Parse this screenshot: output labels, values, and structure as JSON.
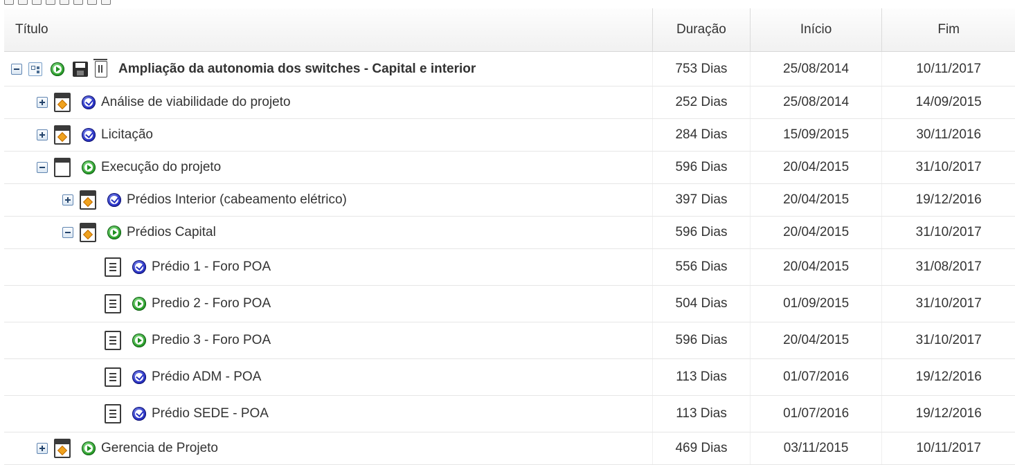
{
  "columns": {
    "title": "Título",
    "duration": "Duração",
    "start": "Início",
    "end": "Fim"
  },
  "rows": [
    {
      "title": "Ampliação da autonomia dos switches - Capital e interior",
      "duration": "753 Dias",
      "start": "25/08/2014",
      "end": "10/11/2017",
      "level": 0,
      "toggle": "minus",
      "status": "in-progress",
      "root": true
    },
    {
      "title": "Análise de viabilidade do projeto",
      "duration": "252 Dias",
      "start": "25/08/2014",
      "end": "14/09/2015",
      "level": 1,
      "toggle": "plus",
      "status": "completed",
      "task_icon": "summary"
    },
    {
      "title": "Licitação",
      "duration": "284 Dias",
      "start": "15/09/2015",
      "end": "30/11/2016",
      "level": 1,
      "toggle": "plus",
      "status": "completed",
      "task_icon": "summary"
    },
    {
      "title": "Execução do projeto",
      "duration": "596 Dias",
      "start": "20/04/2015",
      "end": "31/10/2017",
      "level": 1,
      "toggle": "minus",
      "status": "in-progress",
      "task_icon": "phase"
    },
    {
      "title": "Prédios Interior (cabeamento elétrico)",
      "duration": "397 Dias",
      "start": "20/04/2015",
      "end": "19/12/2016",
      "level": 2,
      "toggle": "plus",
      "status": "completed",
      "task_icon": "summary"
    },
    {
      "title": "Prédios Capital",
      "duration": "596 Dias",
      "start": "20/04/2015",
      "end": "31/10/2017",
      "level": 2,
      "toggle": "minus",
      "status": "in-progress",
      "task_icon": "summary"
    },
    {
      "title": "Prédio 1 - Foro POA",
      "duration": "556 Dias",
      "start": "20/04/2015",
      "end": "31/08/2017",
      "level": 3,
      "toggle": "none",
      "status": "completed",
      "task_icon": "document"
    },
    {
      "title": "Predio 2 - Foro POA",
      "duration": "504 Dias",
      "start": "01/09/2015",
      "end": "31/10/2017",
      "level": 3,
      "toggle": "none",
      "status": "in-progress",
      "task_icon": "document"
    },
    {
      "title": "Predio 3 - Foro POA",
      "duration": "596 Dias",
      "start": "20/04/2015",
      "end": "31/10/2017",
      "level": 3,
      "toggle": "none",
      "status": "in-progress",
      "task_icon": "document"
    },
    {
      "title": "Prédio ADM - POA",
      "duration": "113 Dias",
      "start": "01/07/2016",
      "end": "19/12/2016",
      "level": 3,
      "toggle": "none",
      "status": "completed",
      "task_icon": "document"
    },
    {
      "title": "Prédio SEDE - POA",
      "duration": "113 Dias",
      "start": "01/07/2016",
      "end": "19/12/2016",
      "level": 3,
      "toggle": "none",
      "status": "completed",
      "task_icon": "document"
    },
    {
      "title": "Gerencia de Projeto",
      "duration": "469 Dias",
      "start": "03/11/2015",
      "end": "10/11/2017",
      "level": 1,
      "toggle": "plus",
      "status": "in-progress",
      "task_icon": "summary"
    }
  ],
  "colors": {
    "header_bg": "#f3f3f3",
    "border": "#dadada",
    "in_progress": "#2ca02c",
    "completed": "#2c35c8",
    "summary_diamond": "#f0a21e"
  }
}
